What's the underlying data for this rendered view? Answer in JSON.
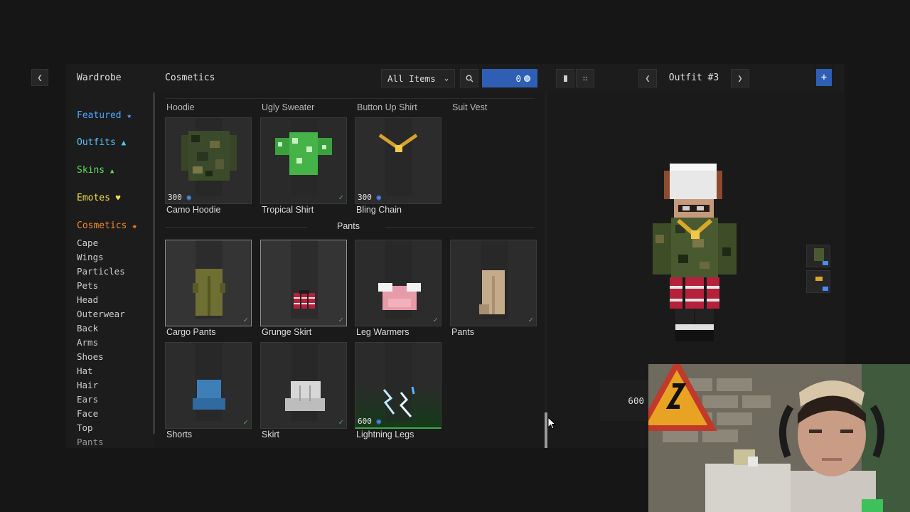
{
  "header": {
    "wardrobe_title": "Wardrobe",
    "cosmetics_title": "Cosmetics",
    "filter_value": "All Items",
    "coin_balance": "0",
    "outfit_title": "Outfit #3"
  },
  "sidebar": {
    "main": [
      {
        "label": "Featured",
        "color": "#4aa8ff",
        "icon": "star-icon"
      },
      {
        "label": "Outfits",
        "color": "#57c3ff",
        "icon": "shirt-icon"
      },
      {
        "label": "Skins",
        "color": "#5edc5e",
        "icon": "person-icon"
      },
      {
        "label": "Emotes",
        "color": "#f3e04f",
        "icon": "heart-icon"
      },
      {
        "label": "Cosmetics",
        "color": "#f28a2e",
        "icon": "crown-icon"
      }
    ],
    "sub": [
      "Cape",
      "Wings",
      "Particles",
      "Pets",
      "Head",
      "Outerwear",
      "Back",
      "Arms",
      "Shoes",
      "Hat",
      "Hair",
      "Ears",
      "Face",
      "Top",
      "Pants"
    ]
  },
  "grid": {
    "top_row_labels": [
      "Hoodie",
      "Ugly Sweater",
      "Button Up Shirt",
      "Suit Vest"
    ],
    "row1": [
      {
        "label": "Camo Hoodie",
        "price": "300",
        "owned": false
      },
      {
        "label": "Tropical Shirt",
        "price": "",
        "owned": true
      },
      {
        "label": "Bling Chain",
        "price": "300",
        "owned": false
      }
    ],
    "section_title": "Pants",
    "row2": [
      {
        "label": "Cargo Pants",
        "price": "",
        "owned": true
      },
      {
        "label": "Grunge Skirt",
        "price": "",
        "owned": true
      },
      {
        "label": "Leg Warmers",
        "price": "",
        "owned": true
      },
      {
        "label": "Pants",
        "price": "",
        "owned": true
      }
    ],
    "row3": [
      {
        "label": "Shorts",
        "price": "",
        "owned": true
      },
      {
        "label": "Skirt",
        "price": "",
        "owned": true
      },
      {
        "label": "Lightning Legs",
        "price": "600",
        "owned": false
      }
    ],
    "check_glyph": "✓"
  },
  "outfit_panel": {
    "total_price": "600"
  },
  "colors": {
    "accent_blue": "#2f5fb4",
    "coin_blue": "#4a8cff",
    "owned_check": "#4caf50"
  }
}
